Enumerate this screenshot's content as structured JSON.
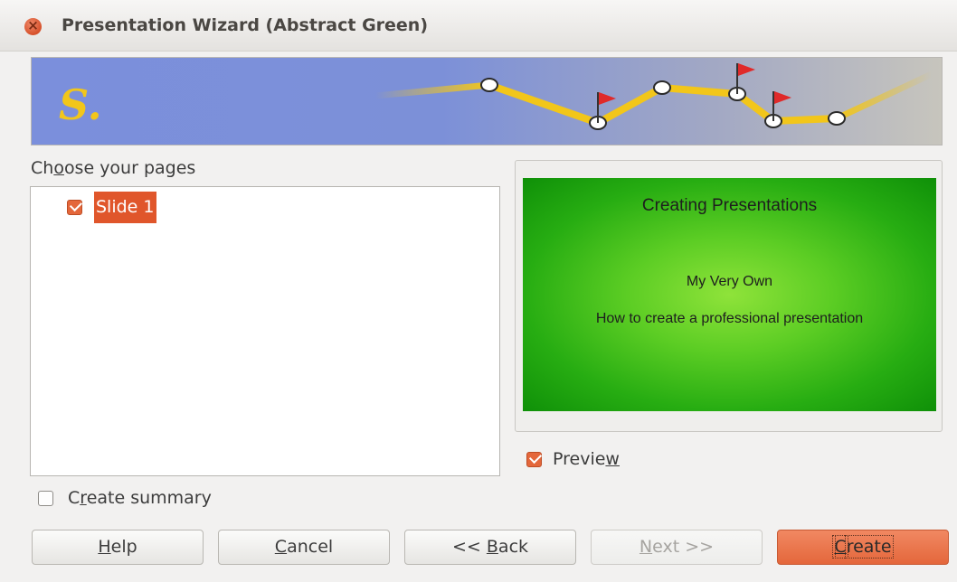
{
  "window": {
    "title": "Presentation Wizard (Abstract Green)"
  },
  "banner": {
    "logo_text": "S."
  },
  "pages_section": {
    "label_pre": "Ch",
    "label_acc": "o",
    "label_post": "ose your pages",
    "items": [
      {
        "label": "Slide 1",
        "checked": true,
        "selected": true
      }
    ]
  },
  "preview": {
    "slide_title": "Creating Presentations",
    "slide_subtitle": "My Very Own",
    "slide_body": "How to create a professional presentation",
    "checkbox_pre": "Previe",
    "checkbox_acc": "w",
    "checkbox_post": "",
    "checked": true
  },
  "summary": {
    "pre": "C",
    "acc": "r",
    "post": "eate summary",
    "checked": false
  },
  "buttons": {
    "help": {
      "pre": "",
      "acc": "H",
      "post": "elp"
    },
    "cancel": {
      "pre": "",
      "acc": "C",
      "post": "ancel"
    },
    "back": {
      "pre": "<< ",
      "acc": "B",
      "post": "ack"
    },
    "next": {
      "pre": "",
      "acc": "N",
      "post": "ext >>",
      "disabled": true
    },
    "create": {
      "pre": "",
      "acc": "C",
      "post": "reate",
      "default": true
    }
  },
  "colors": {
    "accent": "#e4673b",
    "selection": "#e0562b",
    "slide_green": "#27ad12"
  }
}
